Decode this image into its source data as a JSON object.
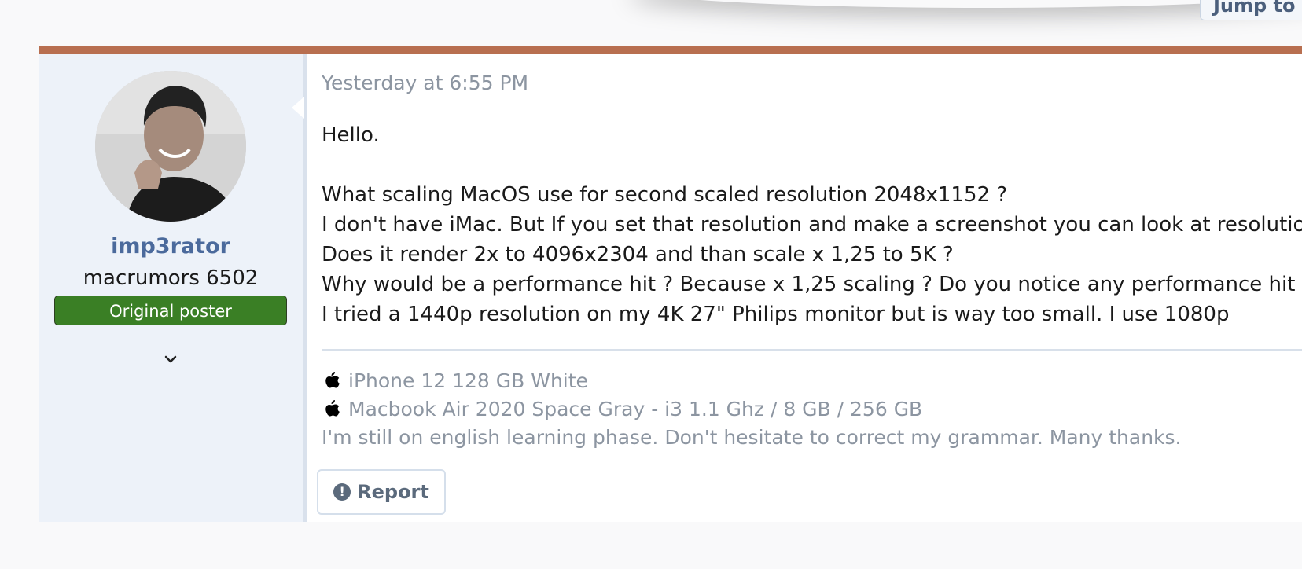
{
  "header": {
    "jump_label": "Jump to"
  },
  "post": {
    "accent_color": "#b86f50",
    "user": {
      "name": "imp3rator",
      "title": "macrumors 6502",
      "badge": "Original poster",
      "avatar_icon": "user-avatar-photo",
      "expand_icon": "chevron-down-icon"
    },
    "date": "Yesterday at 6:55 PM",
    "body": {
      "greeting": "Hello.",
      "lines": [
        "What scaling MacOS use for second scaled resolution 2048x1152 ?",
        "I don't have iMac. But If you set that resolution and make a screenshot you can look at resolution",
        "Does it render 2x to 4096x2304 and than scale x 1,25 to 5K ?",
        "Why would be a performance hit ? Because x 1,25 scaling ? Do you notice any performance hit",
        "I tried a 1440p resolution on my 4K 27\" Philips monitor but is way too small. I use 1080p"
      ]
    },
    "signature": {
      "devices": [
        {
          "icon": "apple-logo-icon",
          "text": "iPhone 12 128 GB White"
        },
        {
          "icon": "apple-logo-icon",
          "text": "Macbook Air 2020 Space Gray - i3 1.1 Ghz / 8 GB / 256 GB"
        }
      ],
      "note": "I'm still on english learning phase. Don't hesitate to correct my grammar. Many thanks."
    },
    "actions": {
      "report_label": "Report",
      "report_icon": "exclamation-circle-icon"
    }
  }
}
